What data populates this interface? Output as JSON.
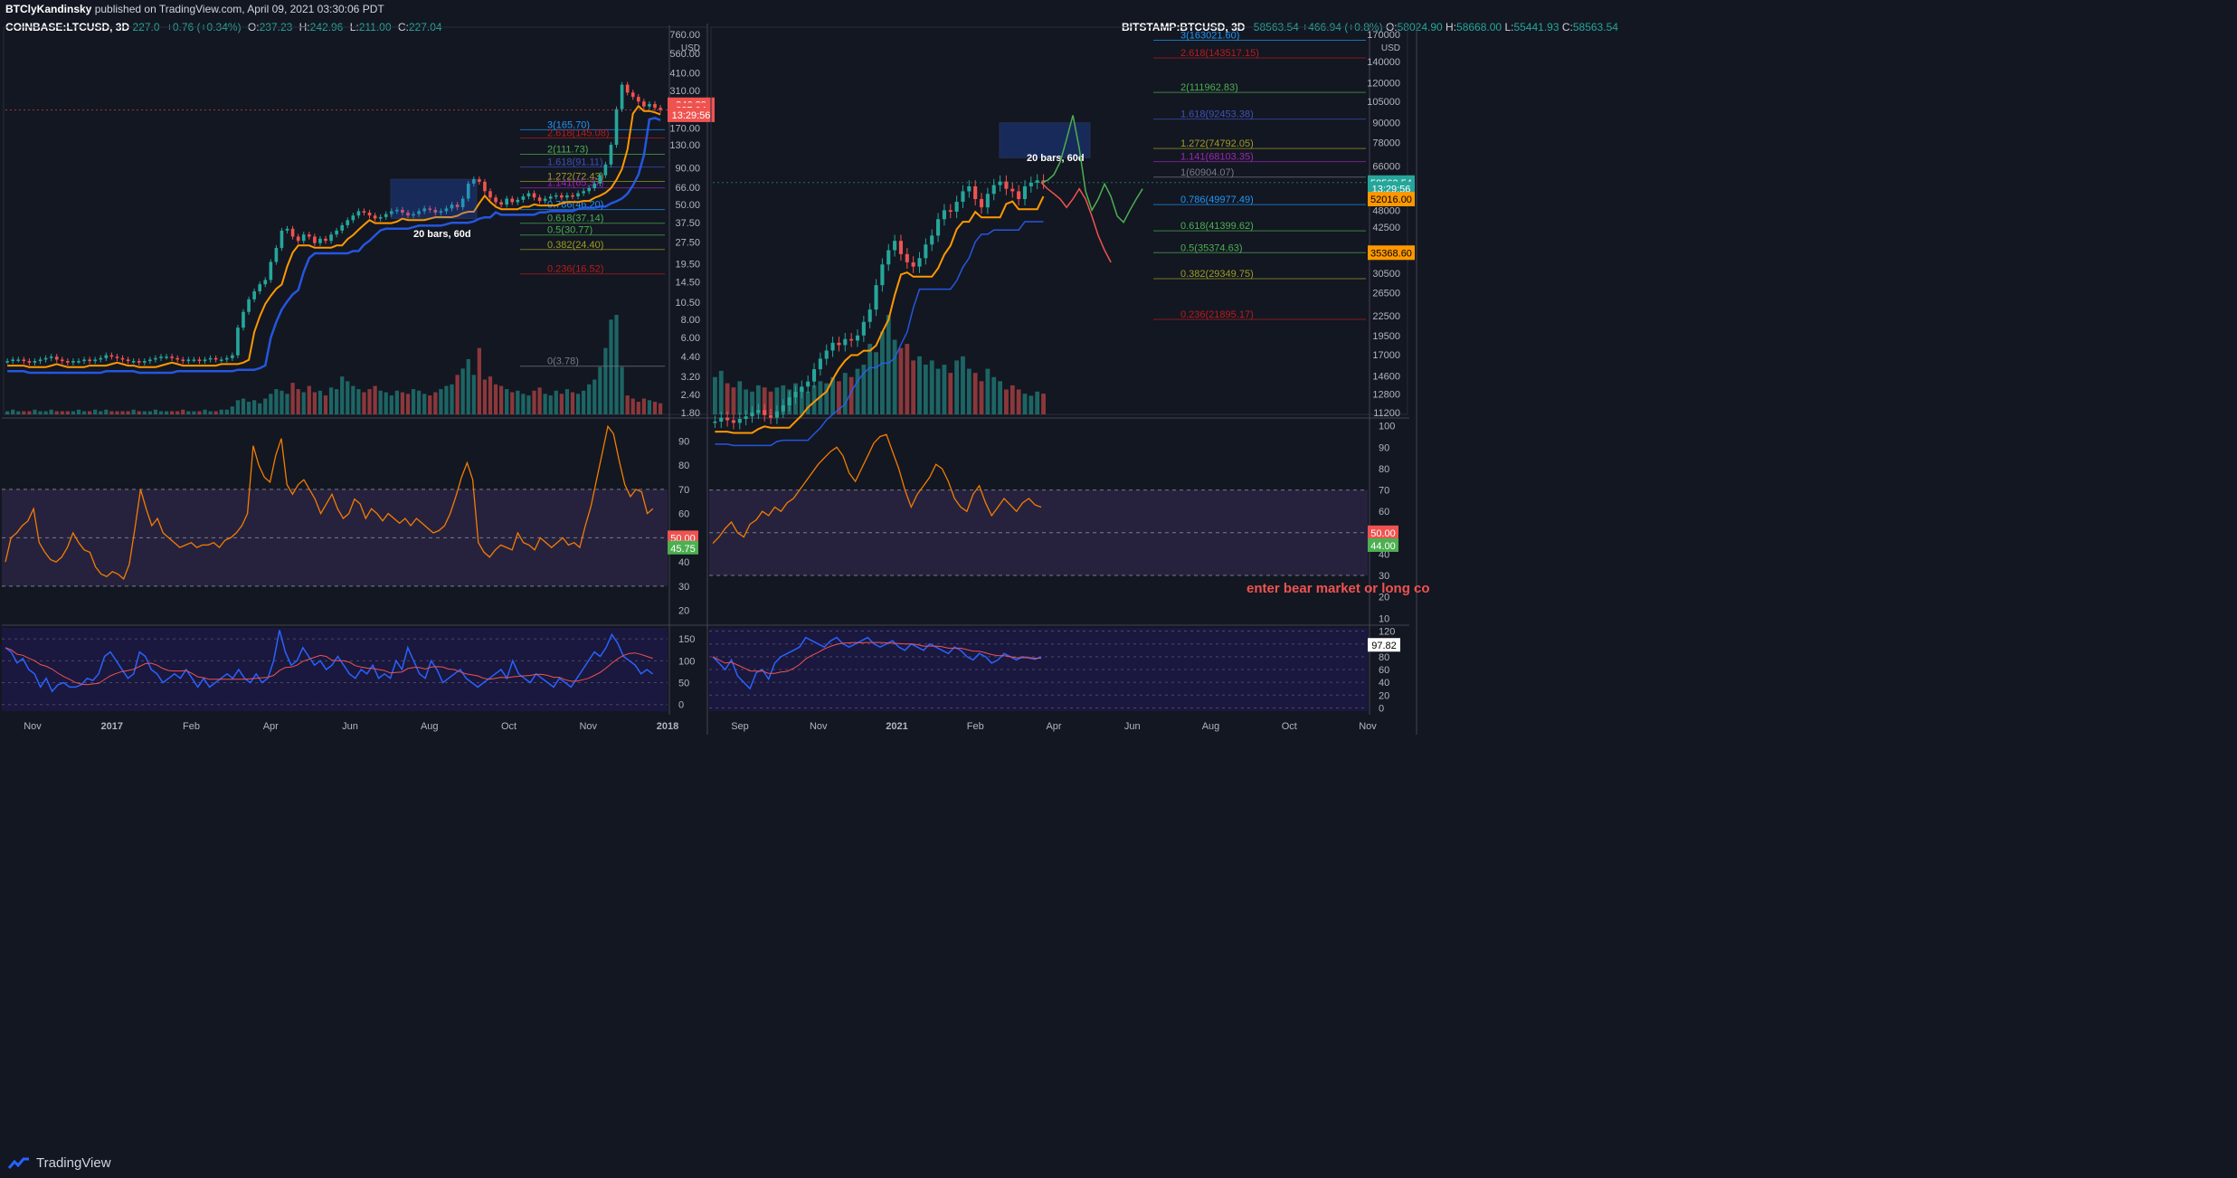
{
  "header": {
    "publisher": "BTClyKandinsky",
    "published_text": "published on TradingView.com, April 09, 2021 03:30:06 PDT"
  },
  "footer": {
    "brand": "TradingView"
  },
  "colors": {
    "bg": "#131722",
    "up": "#26a69a",
    "down": "#ef5350",
    "orange": "#ff9800",
    "blue": "#2962ff",
    "rsi": "#f57c00",
    "green": "#4caf50",
    "yellow": "#e8c45a"
  },
  "chart_data": [
    {
      "id": "ltc",
      "type": "candlestick",
      "symbol_label": "COINBASE:LTCUSD, 3D",
      "ohlc_text": {
        "o": "237.23",
        "h": "242.96",
        "l": "211.00",
        "c": "227.04",
        "change": "+0.76 (+0.34%)",
        "last": "227.0"
      },
      "price_axis": {
        "scale": "log",
        "unit": "USD",
        "ticks": [
          "760.00",
          "560.00",
          "410.00",
          "310.00",
          "220.00",
          "170.00",
          "130.00",
          "90.00",
          "66.00",
          "50.00",
          "37.50",
          "27.50",
          "19.50",
          "14.50",
          "10.50",
          "8.00",
          "6.00",
          "4.40",
          "3.20",
          "2.40",
          "1.80"
        ]
      },
      "price_labels": [
        {
          "text": "246.89",
          "color": "#ef5350",
          "price": 246.89
        },
        {
          "text": "227.04",
          "color": "#ef5350",
          "price": 227.04
        },
        {
          "text": "13:29:56",
          "color": "#ef5350",
          "price": 210
        }
      ],
      "time_axis": [
        "Nov",
        "2017",
        "Feb",
        "Apr",
        "Jun",
        "Aug",
        "Oct",
        "Nov",
        "2018"
      ],
      "fib_levels": [
        {
          "label": "3(165.70)",
          "value": 165.7,
          "color": "#2196f3"
        },
        {
          "label": "2.618(145.08)",
          "value": 145.08,
          "color": "#b71c1c"
        },
        {
          "label": "2(111.73)",
          "value": 111.73,
          "color": "#4caf50"
        },
        {
          "label": "1.618(91.11)",
          "value": 91.11,
          "color": "#3f51b5"
        },
        {
          "label": "1.272(72.43)",
          "value": 72.43,
          "color": "#9e9d24"
        },
        {
          "label": "1.141(65.37)",
          "value": 65.37,
          "color": "#9c27b0"
        },
        {
          "label": "0.786(46.20)",
          "value": 46.2,
          "color": "#2196f3"
        },
        {
          "label": "0.618(37.14)",
          "value": 37.14,
          "color": "#4caf50"
        },
        {
          "label": "0.5(30.77)",
          "value": 30.77,
          "color": "#4caf50"
        },
        {
          "label": "0.382(24.40)",
          "value": 24.4,
          "color": "#9e9d24"
        },
        {
          "label": "0.236(16.52)",
          "value": 16.52,
          "color": "#b71c1c"
        },
        {
          "label": "0(3.78)",
          "value": 3.78,
          "color": "#787b86"
        }
      ],
      "bars_range_label": "20 bars, 60d",
      "close_path": [
        4.1,
        4.2,
        4.2,
        4.1,
        4.0,
        4.1,
        4.2,
        4.3,
        4.4,
        4.2,
        4.1,
        4.0,
        4.1,
        4.1,
        4.2,
        4.1,
        4.2,
        4.3,
        4.5,
        4.4,
        4.3,
        4.2,
        4.1,
        4.1,
        4.0,
        4.1,
        4.2,
        4.3,
        4.4,
        4.4,
        4.3,
        4.2,
        4.1,
        4.2,
        4.2,
        4.1,
        4.2,
        4.3,
        4.2,
        4.2,
        4.3,
        4.5,
        7.0,
        9.0,
        11.0,
        12.5,
        14.0,
        15.0,
        20.0,
        25.0,
        33.0,
        34.0,
        30.0,
        28.0,
        31.0,
        30.0,
        27.0,
        29.0,
        28.0,
        31.0,
        33.0,
        36.0,
        39.0,
        42.0,
        45.0,
        44.0,
        42.0,
        40.0,
        41.0,
        43.0,
        45.0,
        46.0,
        44.0,
        42.0,
        43.0,
        45.0,
        47.0,
        46.0,
        44.0,
        45.0,
        47.0,
        50.0,
        48.0,
        55.0,
        70.0,
        75.0,
        72.0,
        62.0,
        56.0,
        52.0,
        50.0,
        55.0,
        52.0,
        54.0,
        57.0,
        60.0,
        56.0,
        53.0,
        55.0,
        57.0,
        58.0,
        56.0,
        58.0,
        57.0,
        60.0,
        62.0,
        65.0,
        70.0,
        80.0,
        95.0,
        130.0,
        230.0,
        340.0,
        300.0,
        280.0,
        260.0,
        240.0,
        250.0,
        235.0,
        227.0
      ],
      "volume": [
        0.2,
        0.3,
        0.2,
        0.2,
        0.2,
        0.3,
        0.2,
        0.2,
        0.3,
        0.2,
        0.2,
        0.2,
        0.2,
        0.3,
        0.2,
        0.2,
        0.3,
        0.2,
        0.3,
        0.2,
        0.2,
        0.2,
        0.2,
        0.3,
        0.2,
        0.2,
        0.2,
        0.3,
        0.2,
        0.2,
        0.2,
        0.2,
        0.3,
        0.2,
        0.2,
        0.2,
        0.3,
        0.2,
        0.2,
        0.3,
        0.3,
        0.5,
        0.9,
        1.0,
        0.8,
        0.9,
        0.7,
        1.0,
        1.3,
        1.6,
        1.5,
        1.3,
        2.0,
        1.6,
        1.4,
        1.8,
        1.4,
        1.5,
        1.2,
        1.7,
        1.6,
        2.4,
        2.1,
        1.8,
        1.6,
        1.4,
        1.6,
        1.8,
        1.5,
        1.4,
        1.2,
        1.5,
        1.4,
        1.3,
        1.6,
        1.5,
        1.3,
        1.2,
        1.4,
        1.6,
        1.8,
        1.9,
        2.5,
        2.9,
        3.5,
        2.5,
        4.2,
        2.2,
        2.4,
        1.9,
        1.8,
        1.6,
        1.4,
        1.5,
        1.3,
        1.2,
        1.5,
        1.7,
        1.3,
        1.2,
        1.5,
        1.3,
        1.6,
        1.4,
        1.3,
        1.5,
        1.9,
        2.2,
        3.0,
        4.2,
        6.0,
        6.3,
        3.0,
        1.2,
        1.0,
        0.8,
        1.0,
        0.9,
        0.8,
        0.7
      ],
      "rsi_panel": {
        "ticks": [
          "90",
          "80",
          "70",
          "60",
          "50",
          "40",
          "30",
          "20"
        ],
        "labels": [
          {
            "text": "50.00",
            "color": "#ef5350",
            "value": 50
          },
          {
            "text": "45.75",
            "color": "#4caf50",
            "value": 45.75
          }
        ],
        "path": [
          40,
          50,
          52,
          55,
          57,
          62,
          48,
          44,
          41,
          40,
          42,
          46,
          52,
          48,
          45,
          44,
          38,
          35,
          34,
          36,
          35,
          33,
          39,
          54,
          70,
          62,
          55,
          58,
          52,
          50,
          48,
          46,
          47,
          48,
          46,
          47,
          47,
          48,
          46,
          49,
          50,
          52,
          55,
          60,
          88,
          80,
          75,
          73,
          84,
          91,
          72,
          68,
          72,
          74,
          70,
          66,
          60,
          64,
          68,
          62,
          58,
          60,
          66,
          64,
          58,
          62,
          60,
          57,
          60,
          58,
          56,
          58,
          55,
          58,
          56,
          54,
          52,
          53,
          55,
          60,
          67,
          75,
          81,
          74,
          48,
          44,
          42,
          45,
          47,
          46,
          45,
          52,
          48,
          47,
          45,
          50,
          48,
          46,
          48,
          50,
          47,
          48,
          46,
          55,
          63,
          74,
          85,
          96,
          93,
          82,
          72,
          67,
          70,
          69,
          60,
          62
        ],
        "band_upper": 70,
        "band_lower": 30
      },
      "cci_panel": {
        "ticks": [
          "150",
          "100",
          "50",
          "0"
        ],
        "path": [
          130,
          120,
          95,
          105,
          80,
          70,
          40,
          60,
          30,
          45,
          50,
          40,
          40,
          45,
          60,
          55,
          70,
          110,
          120,
          100,
          80,
          60,
          70,
          120,
          110,
          80,
          70,
          50,
          60,
          70,
          60,
          80,
          60,
          40,
          60,
          40,
          50,
          60,
          70,
          60,
          80,
          60,
          50,
          70,
          50,
          60,
          100,
          170,
          120,
          90,
          100,
          130,
          110,
          90,
          100,
          80,
          90,
          110,
          90,
          70,
          60,
          80,
          70,
          90,
          60,
          70,
          60,
          100,
          80,
          130,
          100,
          70,
          60,
          100,
          80,
          50,
          60,
          70,
          80,
          60,
          50,
          40,
          50,
          60,
          70,
          80,
          60,
          100,
          70,
          60,
          50,
          70,
          60,
          50,
          40,
          60,
          50,
          40,
          60,
          80,
          100,
          120,
          110,
          130,
          160,
          140,
          110,
          100,
          90,
          70,
          80,
          70
        ]
      }
    },
    {
      "id": "btc",
      "type": "candlestick",
      "symbol_label": "BITSTAMP:BTCUSD, 3D",
      "ohlc_text": {
        "o": "58024.90",
        "h": "58668.00",
        "l": "55441.93",
        "c": "58563.54",
        "change": "+466.94 (+0.8%)"
      },
      "price_axis": {
        "scale": "log",
        "unit": "USD",
        "ticks": [
          "170000",
          "140000",
          "120000",
          "105000",
          "90000",
          "78000",
          "66000",
          "55000",
          "48000",
          "42500",
          "35000",
          "30500",
          "26500",
          "22500",
          "19500",
          "17000",
          "14600",
          "12800",
          "11200"
        ]
      },
      "price_labels": [
        {
          "text": "58563.54",
          "color": "#26a69a",
          "price": 58563.54
        },
        {
          "text": "13:29:56",
          "color": "#26a69a",
          "price": 56000
        },
        {
          "text": "52016.00",
          "color": "#ff9800",
          "price": 52016
        },
        {
          "text": "35368.60",
          "color": "#ff9800",
          "price": 35368.6
        }
      ],
      "time_axis": [
        "Sep",
        "Nov",
        "2021",
        "Feb",
        "Apr",
        "Jun",
        "Aug",
        "Oct",
        "Nov"
      ],
      "fib_levels": [
        {
          "label": "3(163021.60)",
          "value": 163021.6,
          "color": "#2196f3"
        },
        {
          "label": "2.618(143517.15)",
          "value": 143517.15,
          "color": "#b71c1c"
        },
        {
          "label": "2(111962.83)",
          "value": 111962.83,
          "color": "#4caf50"
        },
        {
          "label": "1.618(92453.38)",
          "value": 92453.38,
          "color": "#3f51b5"
        },
        {
          "label": "1.272(74792.05)",
          "value": 74792.05,
          "color": "#9e9d24"
        },
        {
          "label": "1.141(68103.35)",
          "value": 68103.35,
          "color": "#9c27b0"
        },
        {
          "label": "1(60904.07)",
          "value": 60904.07,
          "color": "#787b86"
        },
        {
          "label": "0.786(49977.49)",
          "value": 49977.49,
          "color": "#2196f3"
        },
        {
          "label": "0.618(41399.62)",
          "value": 41399.62,
          "color": "#4caf50"
        },
        {
          "label": "0.5(35374.63)",
          "value": 35374.63,
          "color": "#4caf50"
        },
        {
          "label": "0.382(29349.75)",
          "value": 29349.75,
          "color": "#9e9d24"
        },
        {
          "label": "0.236(21895.17)",
          "value": 21895.17,
          "color": "#b71c1c"
        }
      ],
      "bars_range_label": "20 bars, 60d",
      "close_path": [
        10500,
        10800,
        10600,
        10400,
        10700,
        10900,
        11200,
        11400,
        11000,
        10800,
        11300,
        11800,
        12500,
        13000,
        13500,
        14000,
        15300,
        16500,
        17500,
        18500,
        18200,
        19000,
        18800,
        19500,
        21500,
        23500,
        28000,
        32500,
        36000,
        38500,
        35000,
        33000,
        32000,
        34000,
        37500,
        40000,
        45000,
        48000,
        47500,
        51000,
        55000,
        57000,
        52000,
        49000,
        54000,
        57500,
        59000,
        56000,
        55000,
        52000,
        57000,
        58500,
        59500,
        58563
      ],
      "volume": [
        1.8,
        2.1,
        1.5,
        1.3,
        1.6,
        1.2,
        1.1,
        1.4,
        1.3,
        1.1,
        1.3,
        1.4,
        1.2,
        1.5,
        1.3,
        1.1,
        1.4,
        1.6,
        1.5,
        1.8,
        1.6,
        2.0,
        1.8,
        2.2,
        2.4,
        3.4,
        3.0,
        4.0,
        4.8,
        3.6,
        3.2,
        3.4,
        2.6,
        2.8,
        2.4,
        2.6,
        2.2,
        2.4,
        2.0,
        2.6,
        2.8,
        2.2,
        2.0,
        1.6,
        2.2,
        1.8,
        1.6,
        1.2,
        1.4,
        1.2,
        1.0,
        0.9,
        1.1,
        1.0
      ],
      "projection_path": [
        58563,
        59500,
        62000,
        68000,
        80000,
        95000,
        75000,
        55000,
        48000,
        52000,
        58000,
        53000,
        46000,
        44000,
        48000,
        52000,
        56000
      ],
      "projection_bear_path": [
        58563,
        56000,
        54000,
        52000,
        49000,
        52000,
        56000,
        52000,
        46000,
        40000,
        36000,
        33000
      ],
      "rsi_panel": {
        "ticks": [
          "100",
          "90",
          "80",
          "70",
          "60",
          "50",
          "40",
          "30",
          "20",
          "10"
        ],
        "labels": [
          {
            "text": "50.00",
            "color": "#ef5350",
            "value": 50
          },
          {
            "text": "44.00",
            "color": "#4caf50",
            "value": 44
          }
        ],
        "path": [
          45,
          48,
          52,
          55,
          50,
          48,
          54,
          56,
          60,
          58,
          62,
          60,
          64,
          66,
          70,
          74,
          78,
          82,
          85,
          88,
          90,
          86,
          78,
          74,
          80,
          86,
          92,
          95,
          96,
          88,
          80,
          70,
          62,
          68,
          72,
          76,
          82,
          80,
          74,
          66,
          62,
          60,
          68,
          72,
          64,
          58,
          62,
          66,
          63,
          60,
          64,
          66,
          63,
          62
        ],
        "band_upper": 70,
        "band_lower": 30,
        "annotation": "enter bear market or long co"
      },
      "cci_panel": {
        "ticks": [
          "120",
          "100",
          "80",
          "60",
          "40",
          "20",
          "0"
        ],
        "labels": [
          {
            "text": "97.82",
            "color": "#ffffff",
            "value": 97.82
          }
        ],
        "path": [
          80,
          70,
          60,
          75,
          50,
          40,
          30,
          55,
          60,
          45,
          70,
          80,
          85,
          90,
          95,
          110,
          105,
          100,
          95,
          105,
          110,
          100,
          95,
          100,
          105,
          110,
          100,
          95,
          100,
          105,
          95,
          90,
          100,
          95,
          90,
          100,
          95,
          90,
          85,
          95,
          90,
          80,
          75,
          85,
          80,
          70,
          75,
          85,
          80,
          75,
          80,
          78,
          76,
          80
        ]
      }
    }
  ]
}
